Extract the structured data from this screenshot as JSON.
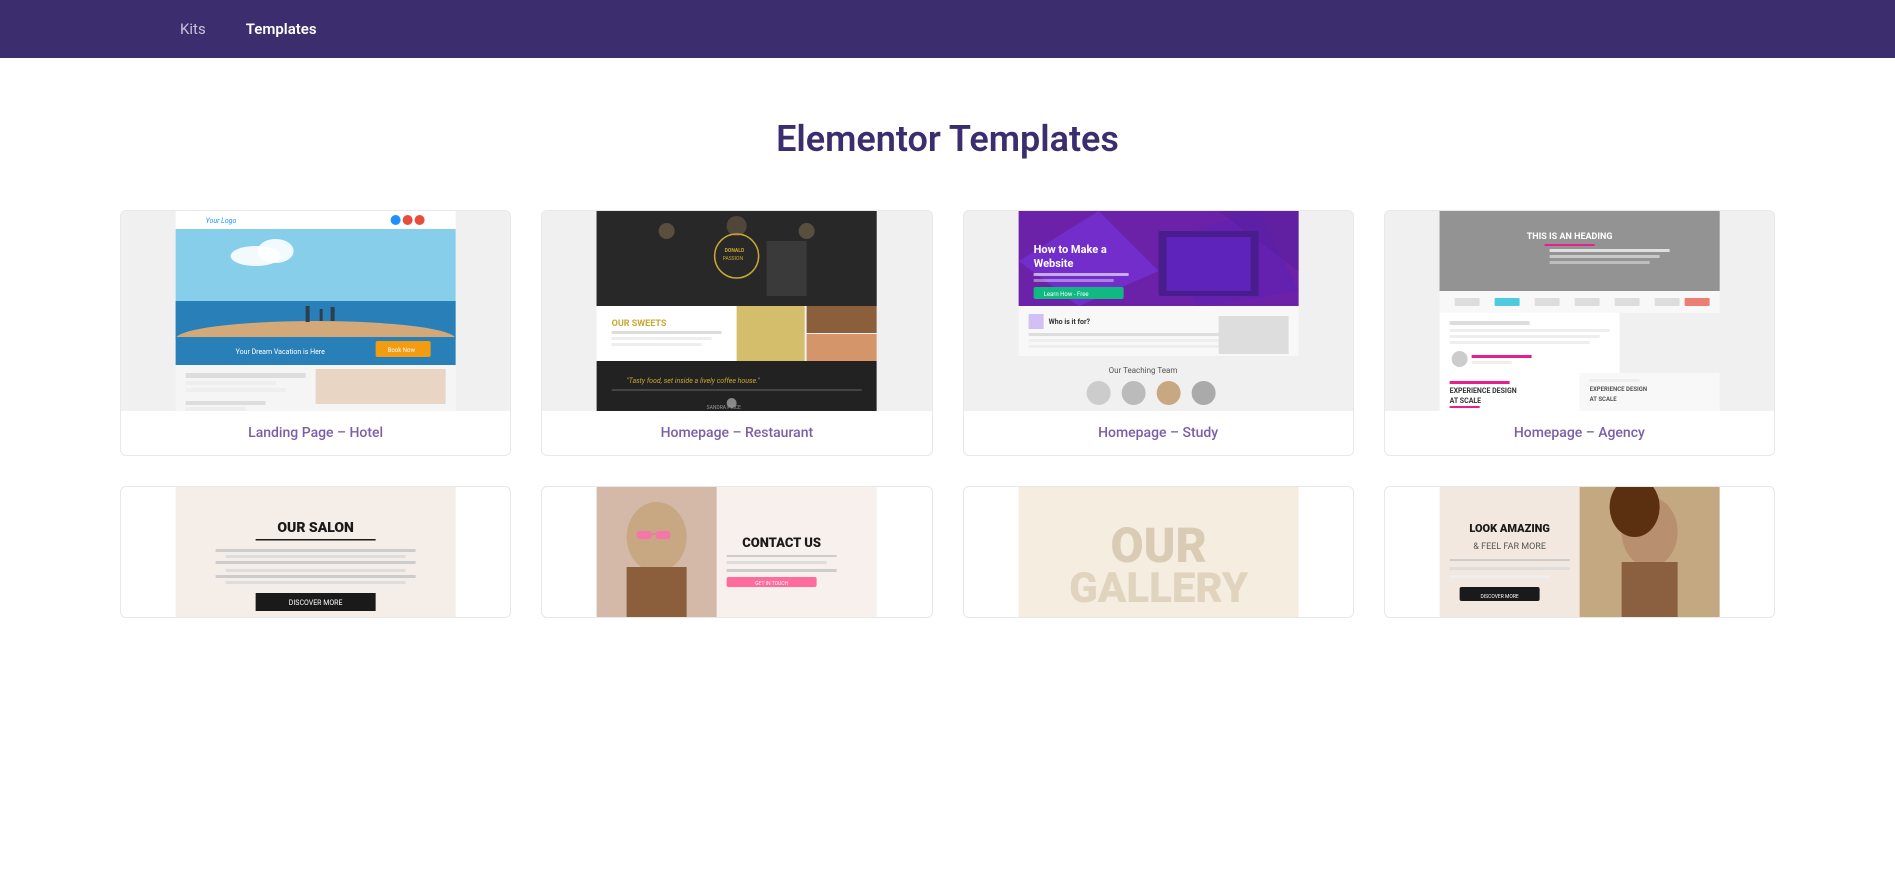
{
  "nav": {
    "items": [
      {
        "id": "kits",
        "label": "Kits",
        "active": false
      },
      {
        "id": "templates",
        "label": "Templates",
        "active": true
      }
    ]
  },
  "page": {
    "title": "Elementor Templates"
  },
  "templates_row1": [
    {
      "id": "landing-hotel",
      "label": "Landing Page – Hotel",
      "thumb_type": "hotel"
    },
    {
      "id": "homepage-restaurant",
      "label": "Homepage – Restaurant",
      "thumb_type": "restaurant"
    },
    {
      "id": "homepage-study",
      "label": "Homepage – Study",
      "thumb_type": "study"
    },
    {
      "id": "homepage-agency",
      "label": "Homepage – Agency",
      "thumb_type": "agency"
    }
  ],
  "templates_row2": [
    {
      "id": "salon",
      "label": "Our Salon",
      "thumb_type": "salon"
    },
    {
      "id": "contact-us",
      "label": "Contact Us",
      "thumb_type": "contact"
    },
    {
      "id": "gallery",
      "label": "Our Gallery",
      "thumb_type": "gallery"
    },
    {
      "id": "beauty",
      "label": "Look Amazing",
      "thumb_type": "beauty"
    }
  ]
}
